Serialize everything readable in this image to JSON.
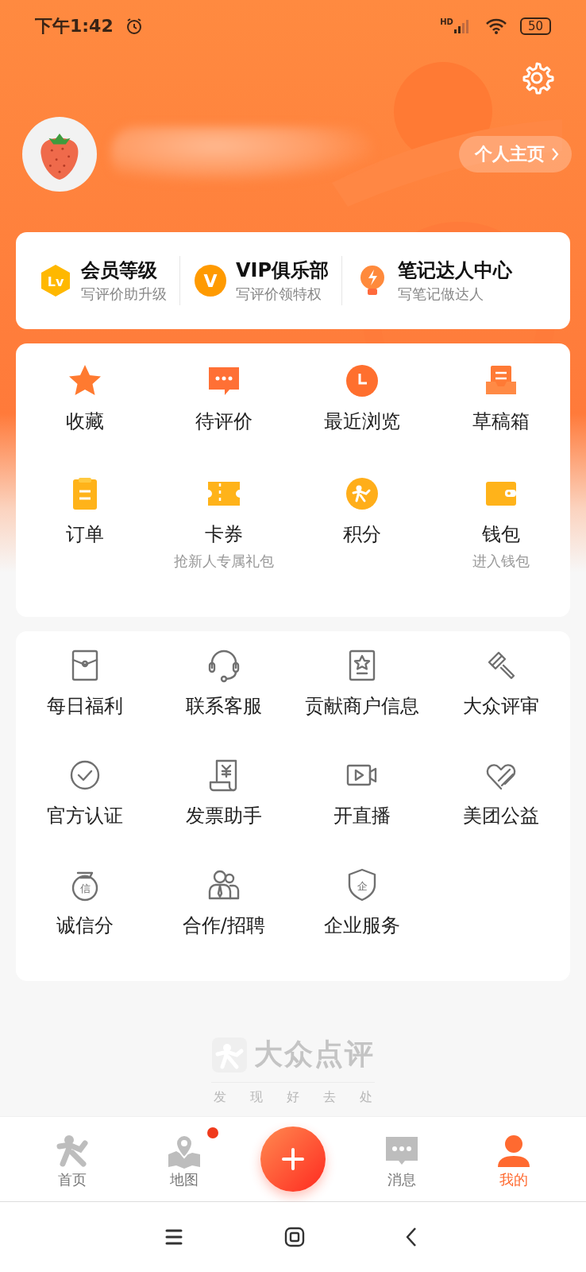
{
  "status_bar": {
    "time": "下午1:42",
    "network": "HD",
    "battery": "50"
  },
  "profile": {
    "home_link": "个人主页"
  },
  "perks": [
    {
      "title": "会员等级",
      "subtitle": "写评价助升级",
      "badge": "Lv"
    },
    {
      "title": "VIP俱乐部",
      "subtitle": "写评价领特权",
      "badge": "V"
    },
    {
      "title": "笔记达人中心",
      "subtitle": "写笔记做达人"
    }
  ],
  "main_grid": [
    {
      "label": "收藏"
    },
    {
      "label": "待评价"
    },
    {
      "label": "最近浏览"
    },
    {
      "label": "草稿箱"
    },
    {
      "label": "订单"
    },
    {
      "label": "卡券",
      "subtitle": "抢新人专属礼包"
    },
    {
      "label": "积分"
    },
    {
      "label": "钱包",
      "subtitle": "进入钱包"
    }
  ],
  "services": [
    {
      "label": "每日福利"
    },
    {
      "label": "联系客服"
    },
    {
      "label": "贡献商户信息"
    },
    {
      "label": "大众评审"
    },
    {
      "label": "官方认证"
    },
    {
      "label": "发票助手"
    },
    {
      "label": "开直播"
    },
    {
      "label": "美团公益"
    },
    {
      "label": "诚信分",
      "badge": "信"
    },
    {
      "label": "合作/招聘"
    },
    {
      "label": "企业服务",
      "badge": "企"
    }
  ],
  "footer": {
    "brand": "大众点评",
    "slogan": [
      "发",
      "现",
      "好",
      "去",
      "处"
    ]
  },
  "tab_bar": [
    {
      "kind": "tab",
      "label": "首页",
      "selected": false,
      "badge": false
    },
    {
      "kind": "tab",
      "label": "地图",
      "selected": false,
      "badge": true
    },
    {
      "kind": "add"
    },
    {
      "kind": "tab",
      "label": "消息",
      "selected": false,
      "badge": false
    },
    {
      "kind": "tab",
      "label": "我的",
      "selected": true,
      "badge": false
    }
  ]
}
